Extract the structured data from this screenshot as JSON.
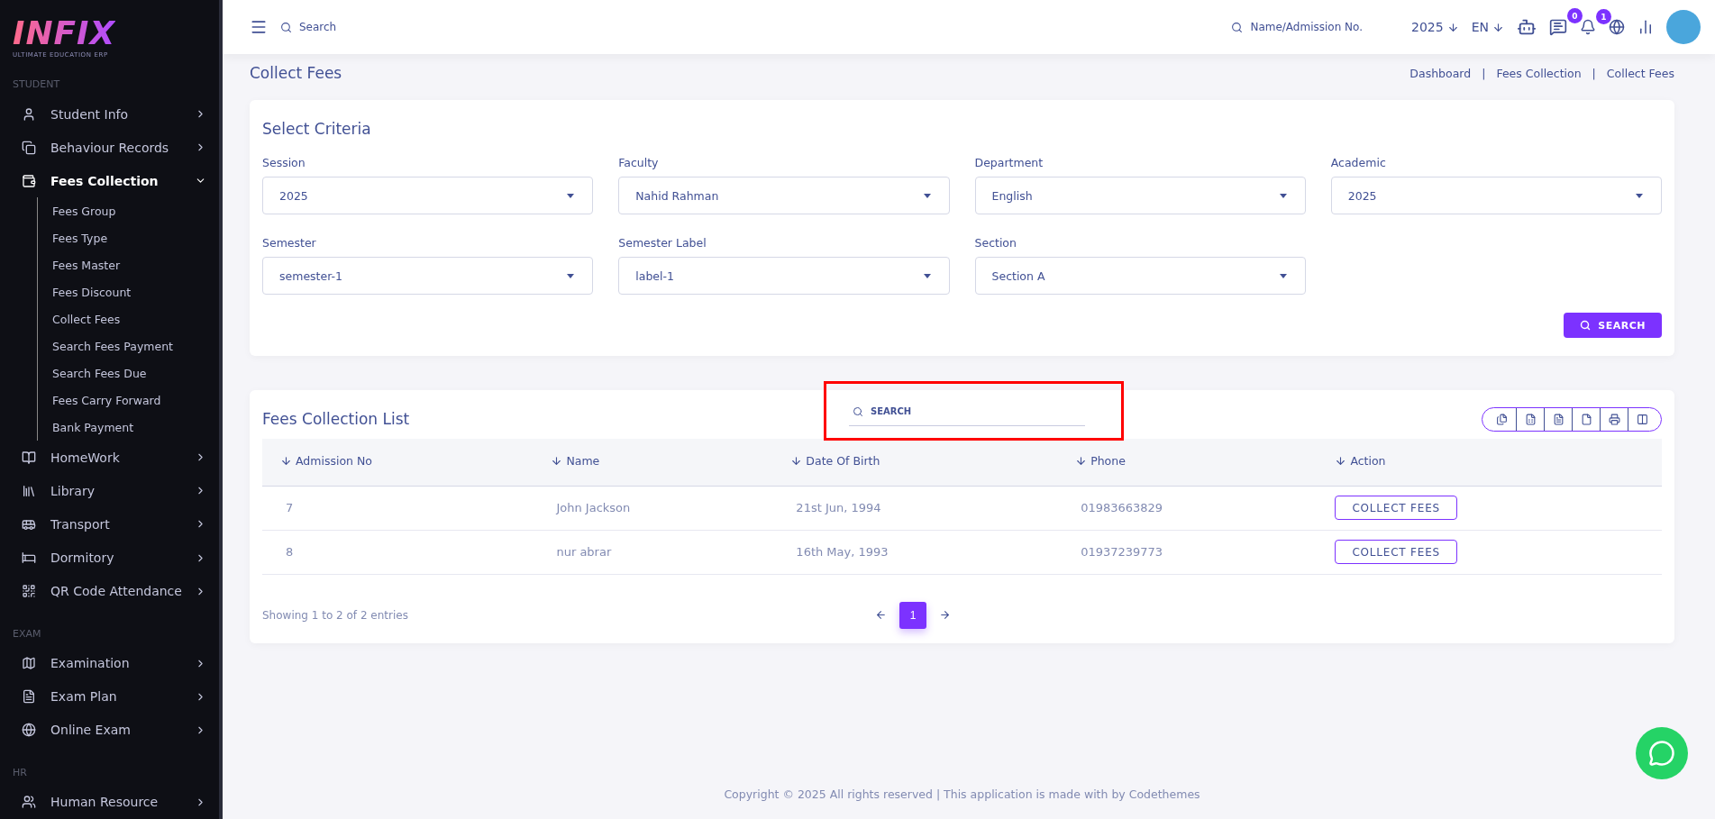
{
  "logo": {
    "word": "INFIX",
    "tagline": "ULTIMATE EDUCATION ERP"
  },
  "sidebar": {
    "sections": [
      {
        "heading": "STUDENT",
        "items": [
          {
            "label": "Student Info",
            "expanded": false,
            "selected": false
          },
          {
            "label": "Behaviour Records",
            "expanded": false,
            "selected": false
          },
          {
            "label": "Fees Collection",
            "expanded": true,
            "selected": true,
            "children": [
              {
                "label": "Fees Group"
              },
              {
                "label": "Fees Type"
              },
              {
                "label": "Fees Master"
              },
              {
                "label": "Fees Discount"
              },
              {
                "label": "Collect Fees"
              },
              {
                "label": "Search Fees Payment"
              },
              {
                "label": "Search Fees Due"
              },
              {
                "label": "Fees Carry Forward"
              },
              {
                "label": "Bank Payment"
              }
            ]
          },
          {
            "label": "HomeWork",
            "expanded": false,
            "selected": false
          },
          {
            "label": "Library",
            "expanded": false,
            "selected": false
          },
          {
            "label": "Transport",
            "expanded": false,
            "selected": false
          },
          {
            "label": "Dormitory",
            "expanded": false,
            "selected": false
          },
          {
            "label": "QR Code Attendance",
            "expanded": false,
            "selected": false
          }
        ]
      },
      {
        "heading": "EXAM",
        "items": [
          {
            "label": "Examination",
            "expanded": false,
            "selected": false
          },
          {
            "label": "Exam Plan",
            "expanded": false,
            "selected": false
          },
          {
            "label": "Online Exam",
            "expanded": false,
            "selected": false
          }
        ]
      },
      {
        "heading": "HR",
        "items": [
          {
            "label": "Human Resource",
            "expanded": false,
            "selected": false
          }
        ]
      }
    ]
  },
  "header": {
    "search_placeholder": "Search",
    "student_search_placeholder": "Name/Admission No.",
    "year": "2025",
    "language": "EN",
    "messages_count": "0",
    "notifications_count": "1"
  },
  "page": {
    "title": "Collect Fees",
    "breadcrumb": [
      "Dashboard",
      "Fees Collection",
      "Collect Fees"
    ],
    "breadcrumb_separator": "|"
  },
  "criteria": {
    "title": "Select Criteria",
    "fields": [
      {
        "label": "Session",
        "value": "2025"
      },
      {
        "label": "Faculty",
        "value": "Nahid Rahman"
      },
      {
        "label": "Department",
        "value": "English"
      },
      {
        "label": "Academic",
        "value": "2025"
      },
      {
        "label": "Semester",
        "value": "semester-1"
      },
      {
        "label": "Semester Label",
        "value": "label-1"
      },
      {
        "label": "Section",
        "value": "Section A"
      }
    ],
    "button": "SEARCH"
  },
  "list": {
    "title": "Fees Collection List",
    "search_placeholder": "SEARCH",
    "highlighted_search": true,
    "columns": [
      "Admission No",
      "Name",
      "Date Of Birth",
      "Phone",
      "Action"
    ],
    "rows": [
      {
        "admission_no": "7",
        "name": "John Jackson",
        "dob": "21st Jun, 1994",
        "phone": "01983663829",
        "action": "COLLECT FEES"
      },
      {
        "admission_no": "8",
        "name": "nur abrar",
        "dob": "16th May, 1993",
        "phone": "01937239773",
        "action": "COLLECT FEES"
      }
    ],
    "summary": "Showing 1 to 2 of 2 entries",
    "pages": [
      {
        "label": "1",
        "selected": true
      }
    ]
  },
  "footer": "Copyright © 2025 All rights reserved | This application is made with by Codethemes"
}
